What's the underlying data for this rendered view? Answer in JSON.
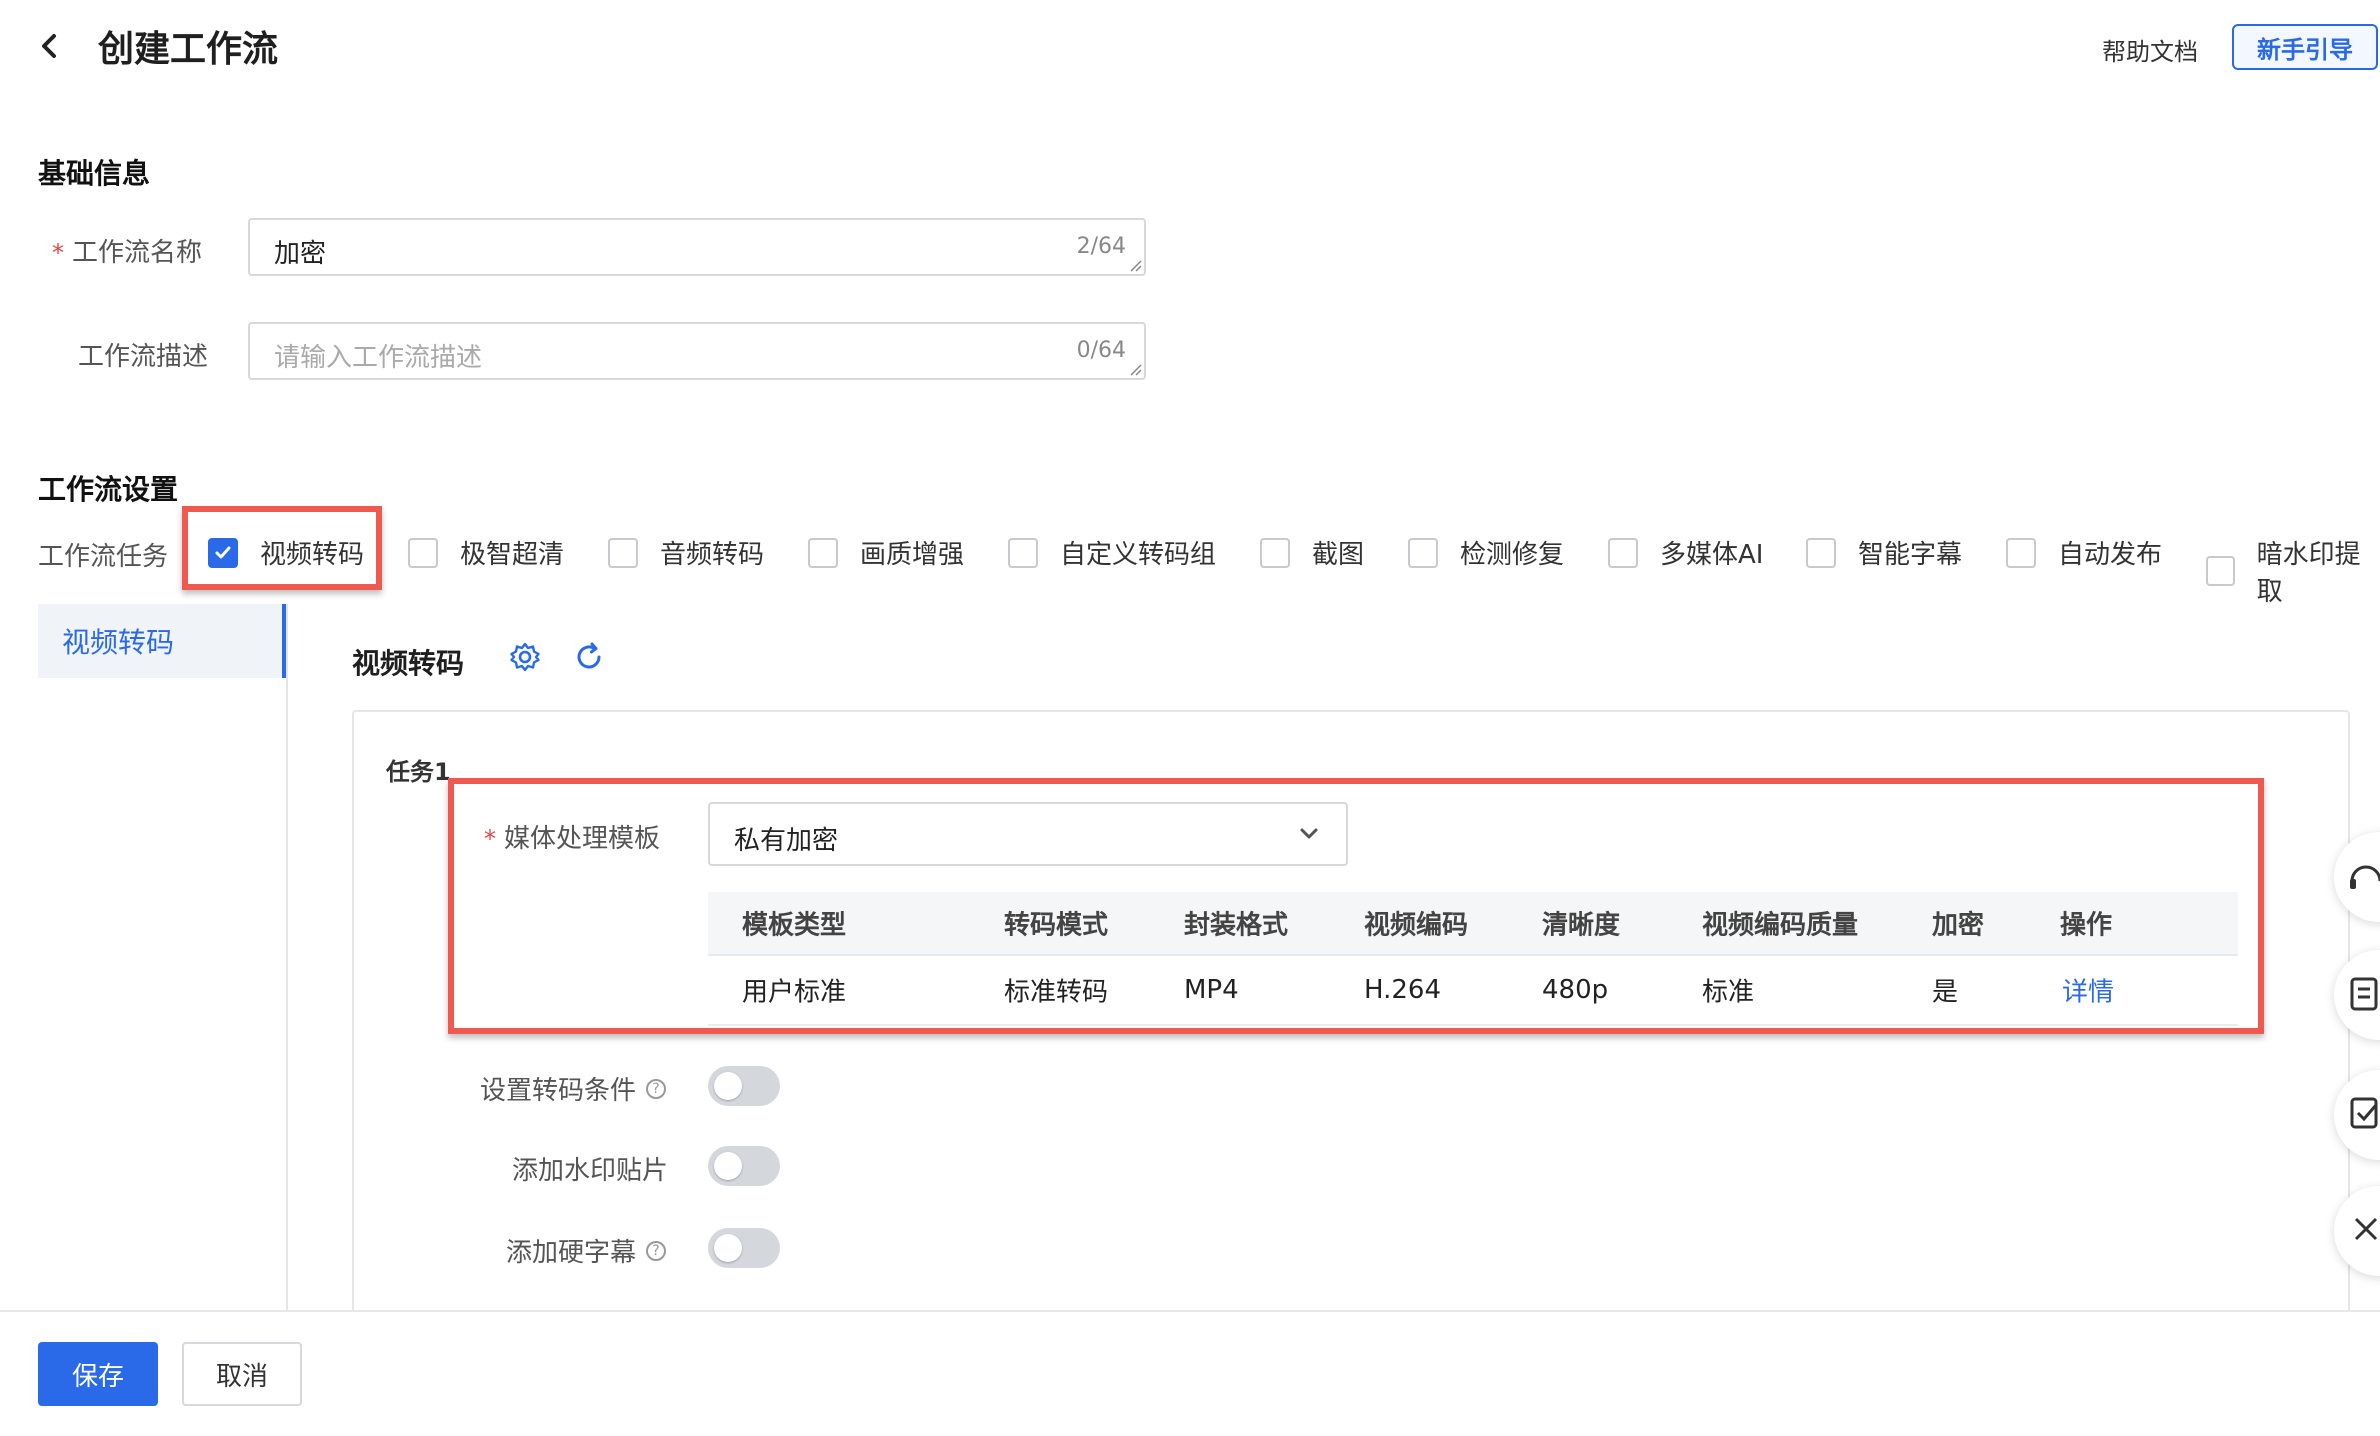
{
  "header": {
    "title": "创建工作流",
    "help_doc": "帮助文档",
    "guide": "新手引导"
  },
  "basic_info": {
    "section_title": "基础信息",
    "required_mark": "*",
    "name_label": "工作流名称",
    "name_value": "加密",
    "name_count": "2/64",
    "desc_label": "工作流描述",
    "desc_placeholder": "请输入工作流描述",
    "desc_count": "0/64"
  },
  "workflow_settings": {
    "section_title": "工作流设置",
    "tasks_label": "工作流任务",
    "tasks": [
      {
        "label": "视频转码",
        "checked": true
      },
      {
        "label": "极智超清",
        "checked": false
      },
      {
        "label": "音频转码",
        "checked": false
      },
      {
        "label": "画质增强",
        "checked": false
      },
      {
        "label": "自定义转码组",
        "checked": false
      },
      {
        "label": "截图",
        "checked": false
      },
      {
        "label": "检测修复",
        "checked": false
      },
      {
        "label": "多媒体AI",
        "checked": false
      },
      {
        "label": "智能字幕",
        "checked": false
      },
      {
        "label": "自动发布",
        "checked": false
      },
      {
        "label": "暗水印提取",
        "checked": false
      }
    ]
  },
  "side_tabs": [
    {
      "label": "视频转码",
      "active": true
    }
  ],
  "panel": {
    "title": "视频转码",
    "task_title": "任务1",
    "template_label": "媒体处理模板",
    "template_value": "私有加密",
    "table": {
      "headers": [
        "模板类型",
        "转码模式",
        "封装格式",
        "视频编码",
        "清晰度",
        "视频编码质量",
        "加密",
        "操作"
      ],
      "rows": [
        [
          "用户标准",
          "标准转码",
          "MP4",
          "H.264",
          "480p",
          "标准",
          "是",
          "详情"
        ]
      ]
    },
    "switches": [
      {
        "label": "设置转码条件",
        "has_help": true,
        "on": false
      },
      {
        "label": "添加水印贴片",
        "has_help": false,
        "on": false
      },
      {
        "label": "添加硬字幕",
        "has_help": true,
        "on": false
      }
    ],
    "help_glyph": "?"
  },
  "footer": {
    "save": "保存",
    "cancel": "取消"
  },
  "colors": {
    "primary": "#2a6ae9",
    "highlight": "#ee5a4f",
    "required": "#e54545"
  }
}
